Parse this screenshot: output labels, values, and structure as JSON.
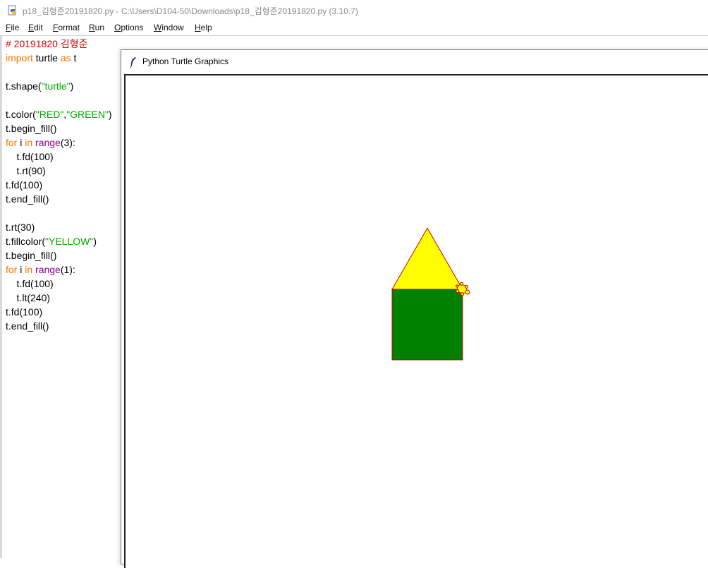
{
  "window": {
    "title": "p18_김형준20191820.py - C:\\Users\\D104-50\\Downloads\\p18_김형준20191820.py (3.10.7)",
    "icon": "python-file-icon"
  },
  "menu": {
    "items": [
      {
        "label": "File",
        "underline": "F",
        "rest": "ile"
      },
      {
        "label": "Edit",
        "underline": "E",
        "rest": "dit"
      },
      {
        "label": "Format",
        "underline": "F",
        "rest": "ormat"
      },
      {
        "label": "Run",
        "underline": "R",
        "rest": "un"
      },
      {
        "label": "Options",
        "underline": "O",
        "rest": "ptions"
      },
      {
        "label": "Window",
        "underline": "W",
        "rest": "indow"
      },
      {
        "label": "Help",
        "underline": "H",
        "rest": "elp"
      }
    ]
  },
  "editor": {
    "lines": [
      [
        {
          "t": "# 20191820 김형준",
          "c": "comment"
        }
      ],
      [
        {
          "t": "import",
          "c": "keyword"
        },
        {
          "t": " turtle ",
          "c": "plain"
        },
        {
          "t": "as",
          "c": "keyword"
        },
        {
          "t": " t",
          "c": "plain"
        }
      ],
      [],
      [
        {
          "t": "t.shape(",
          "c": "plain"
        },
        {
          "t": "\"turtle\"",
          "c": "string"
        },
        {
          "t": ")",
          "c": "plain"
        }
      ],
      [],
      [
        {
          "t": "t.color(",
          "c": "plain"
        },
        {
          "t": "\"RED\"",
          "c": "string"
        },
        {
          "t": ",",
          "c": "plain"
        },
        {
          "t": "\"GREEN\"",
          "c": "string"
        },
        {
          "t": ")",
          "c": "plain"
        }
      ],
      [
        {
          "t": "t.begin_fill()",
          "c": "plain"
        }
      ],
      [
        {
          "t": "for",
          "c": "keyword"
        },
        {
          "t": " i ",
          "c": "plain"
        },
        {
          "t": "in",
          "c": "keyword"
        },
        {
          "t": " ",
          "c": "plain"
        },
        {
          "t": "range",
          "c": "builtin"
        },
        {
          "t": "(3):",
          "c": "plain"
        }
      ],
      [
        {
          "t": "    t.fd(100)",
          "c": "plain"
        }
      ],
      [
        {
          "t": "    t.rt(90)",
          "c": "plain"
        }
      ],
      [
        {
          "t": "t.fd(100)",
          "c": "plain"
        }
      ],
      [
        {
          "t": "t.end_fill()",
          "c": "plain"
        }
      ],
      [],
      [
        {
          "t": "t.rt(30)",
          "c": "plain"
        }
      ],
      [
        {
          "t": "t.fillcolor(",
          "c": "plain"
        },
        {
          "t": "\"YELLOW\"",
          "c": "string"
        },
        {
          "t": ")",
          "c": "plain"
        }
      ],
      [
        {
          "t": "t.begin_fill()",
          "c": "plain"
        }
      ],
      [
        {
          "t": "for",
          "c": "keyword"
        },
        {
          "t": " i ",
          "c": "plain"
        },
        {
          "t": "in",
          "c": "keyword"
        },
        {
          "t": " ",
          "c": "plain"
        },
        {
          "t": "range",
          "c": "builtin"
        },
        {
          "t": "(1):",
          "c": "plain"
        }
      ],
      [
        {
          "t": "    t.fd(100)",
          "c": "plain"
        }
      ],
      [
        {
          "t": "    t.lt(240)",
          "c": "plain"
        }
      ],
      [
        {
          "t": "t.fd(100)",
          "c": "plain"
        }
      ],
      [
        {
          "t": "t.end_fill()",
          "c": "plain"
        }
      ]
    ]
  },
  "turtle_window": {
    "title": "Python Turtle Graphics",
    "icon": "feather-icon"
  },
  "drawing": {
    "pen_color": "#cc0000",
    "square_fill": "#008000",
    "triangle_fill": "#ffff00",
    "turtle_fill": "#ffff00",
    "turtle_outline": "#cc0000",
    "side_length": 100,
    "turtle_heading_deg": 30
  },
  "colors": {
    "comment": "#dd0000",
    "keyword": "#ff7700",
    "string": "#00aa00",
    "builtin": "#900090"
  }
}
